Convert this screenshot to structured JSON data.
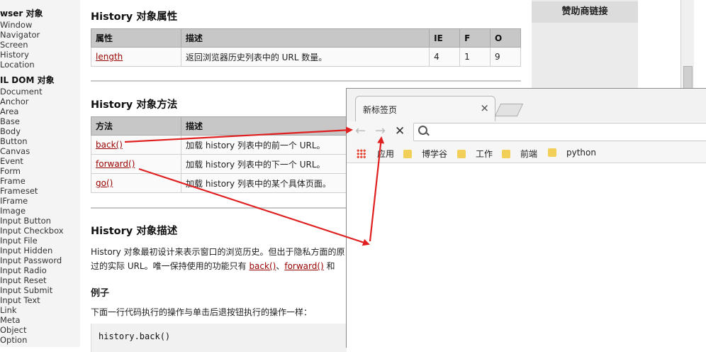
{
  "sidebar": {
    "section1": "wser 对象",
    "items1": [
      "Window",
      "Navigator",
      "Screen",
      "History",
      "Location"
    ],
    "section2": "IL DOM 对象",
    "items2": [
      "Document",
      "Anchor",
      "Area",
      "Base",
      "Body",
      "Button",
      "Canvas",
      "Event",
      "Form",
      "Frame",
      "Frameset",
      "IFrame",
      "Image",
      "Input Button",
      "Input Checkbox",
      "Input File",
      "Input Hidden",
      "Input Password",
      "Input Radio",
      "Input Reset",
      "Input Submit",
      "Input Text",
      "Link",
      "Meta",
      "Object",
      "Option"
    ]
  },
  "main": {
    "props_title": "History 对象属性",
    "props_headers": [
      "属性",
      "描述",
      "IE",
      "F",
      "O"
    ],
    "props_rows": [
      {
        "name": "length",
        "desc": "返回浏览器历史列表中的 URL 数量。",
        "ie": "4",
        "f": "1",
        "o": "9"
      }
    ],
    "methods_title": "History 对象方法",
    "methods_headers": [
      "方法",
      "描述"
    ],
    "methods_rows": [
      {
        "name": "back()",
        "desc": "加载 history 列表中的前一个 URL。"
      },
      {
        "name": "forward()",
        "desc": "加载 history 列表中的下一个 URL。"
      },
      {
        "name": "go()",
        "desc": "加载 history 列表中的某个具体页面。"
      }
    ],
    "desc_title": "History 对象描述",
    "desc_line1": "History 对象最初设计来表示窗口的浏览历史。但出于隐私方面的原",
    "desc_line2_a": "过的实际 URL。唯一保持使用的功能只有 ",
    "desc_link_back": "back()",
    "desc_sep": "、",
    "desc_link_forward": "forward()",
    "desc_line2_b": " 和",
    "example_title": "例子",
    "example_text": "下面一行代码执行的操作与单击后退按钮执行的操作一样：",
    "code": "history.back()"
  },
  "right": {
    "sponsor_title": "赞助商链接"
  },
  "browser": {
    "tab_title": "新标签页",
    "close_glyph": "×",
    "back_glyph": "←",
    "forward_glyph": "→",
    "stop_glyph": "✕",
    "bookmarks": [
      "应用",
      "博学谷",
      "工作",
      "前端",
      "python"
    ]
  },
  "colors": {
    "arrow": "#e02020",
    "link": "#990000",
    "folder": "#f2cf58"
  }
}
